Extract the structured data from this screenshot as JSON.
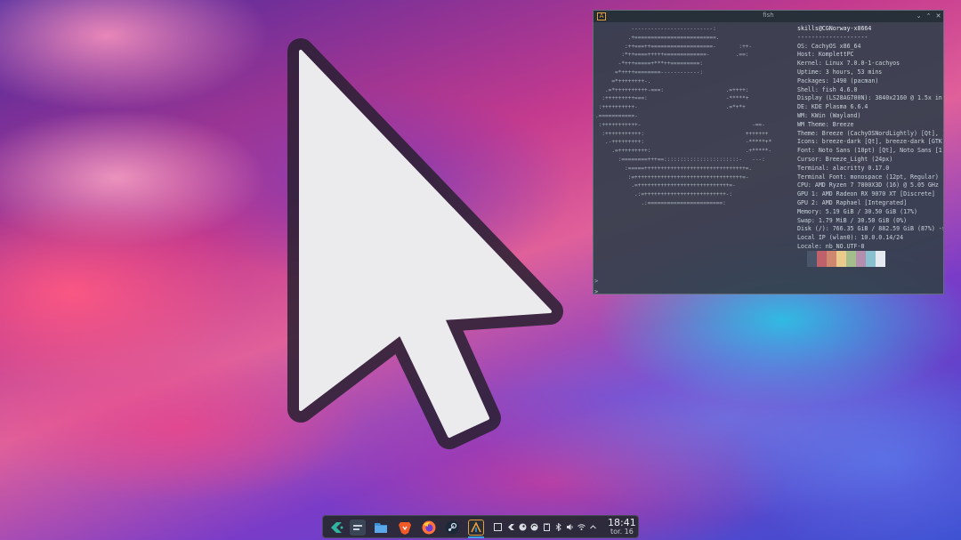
{
  "terminal": {
    "title": "fish",
    "logo_lines": [
      "           -------------------------:",
      "          .+=========================.",
      "         :++===++===================-       :++-",
      "        :*++====+++++=============-        .==:",
      "       -*+++=====+***++=========:",
      "      =*++++========------------:",
      "     =*++++++++-.",
      "   .=*++++++++++-===:                   .=++++:",
      "  :+++++++++===:                        -*****+",
      " :++++++++++-                           .=*+*+",
      ".===========-",
      " :+++++++++++-                                  -==-",
      "  :+++++++++++:                               +++++++",
      "   .-+++++++++:                               -*****+*",
      "     .=+++++++++:                             .+*****-",
      "       :========+++==:::::::::::::::::::::::-   ---:",
      "         :=====+++++++++++++++++++++++++++++++=.",
      "          :=+++++++++++++++++++++++++++++++++=-",
      "           .=++++++++++++++++++++++++++++=-",
      "            .:=+++++++++++++++++++++++++-:",
      "              .:=======================:"
    ],
    "info_lines": [
      "skills@CGNorway-x8664",
      "--------------------",
      "OS: CachyOS x86_64",
      "Host: KomplettPC",
      "Kernel: Linux 7.0.0-1-cachyos",
      "Uptime: 3 hours, 53 mins",
      "Packages: 1490 (pacman)",
      "Shell: fish 4.6.0",
      "Display (LS28AG700N): 3840x2160 @ 1.5x in",
      "DE: KDE Plasma 6.6.4",
      "WM: KWin (Wayland)",
      "WM Theme: Breeze",
      "Theme: Breeze (CachyOSNordLightly) [Qt], ]",
      "Icons: breeze-dark [Qt], breeze-dark [GTK]",
      "Font: Noto Sans (10pt) [Qt], Noto Sans [1]",
      "Cursor: Breeze_Light (24px)",
      "Terminal: alacritty 0.17.0",
      "Terminal Font: monospace (12pt, Regular)",
      "CPU: AMD Ryzen 7 7800X3D (16) @ 5.05 GHz",
      "GPU 1: AMD Radeon RX 9070 XT [Discrete]",
      "GPU 2: AMD Raphael [Integrated]",
      "Memory: 5.19 GiB / 30.50 GiB (17%)",
      "Swap: 1.79 MiB / 30.50 GiB (0%)",
      "Disk (/): 766.35 GiB / 882.59 GiB (87%) -s",
      "Local IP (wlan0): 10.0.0.14/24",
      "Locale: nb_NO.UTF-8"
    ],
    "palette": [
      "#4c566a",
      "#bf616a",
      "#d08770",
      "#ebcb8b",
      "#a3be8c",
      "#b48ead",
      "#88c0d0",
      "#e5e9f0"
    ],
    "prompt_char": ">",
    "prompt_line": "> _"
  },
  "taskbar": {
    "apps": [
      {
        "name": "cachyos-launcher-icon",
        "color": "#2fb59f"
      },
      {
        "name": "system-settings-icon",
        "color": "#3a4656"
      },
      {
        "name": "file-manager-icon",
        "color": "#3d8fd6"
      },
      {
        "name": "brave-browser-icon",
        "color": "#f05a28"
      },
      {
        "name": "firefox-icon",
        "color": "#ff7139"
      },
      {
        "name": "steam-icon",
        "color": "#1b2838"
      },
      {
        "name": "terminal-icon",
        "color": "#2a2e38"
      }
    ],
    "tray": [
      "window-list-icon",
      "cachyos-tray-icon",
      "steam-tray-icon",
      "sync-icon",
      "clipboard-icon",
      "bluetooth-icon",
      "volume-icon",
      "network-icon",
      "chevron-up-icon"
    ],
    "clock_time": "18:41",
    "clock_date": "tor. 16"
  }
}
